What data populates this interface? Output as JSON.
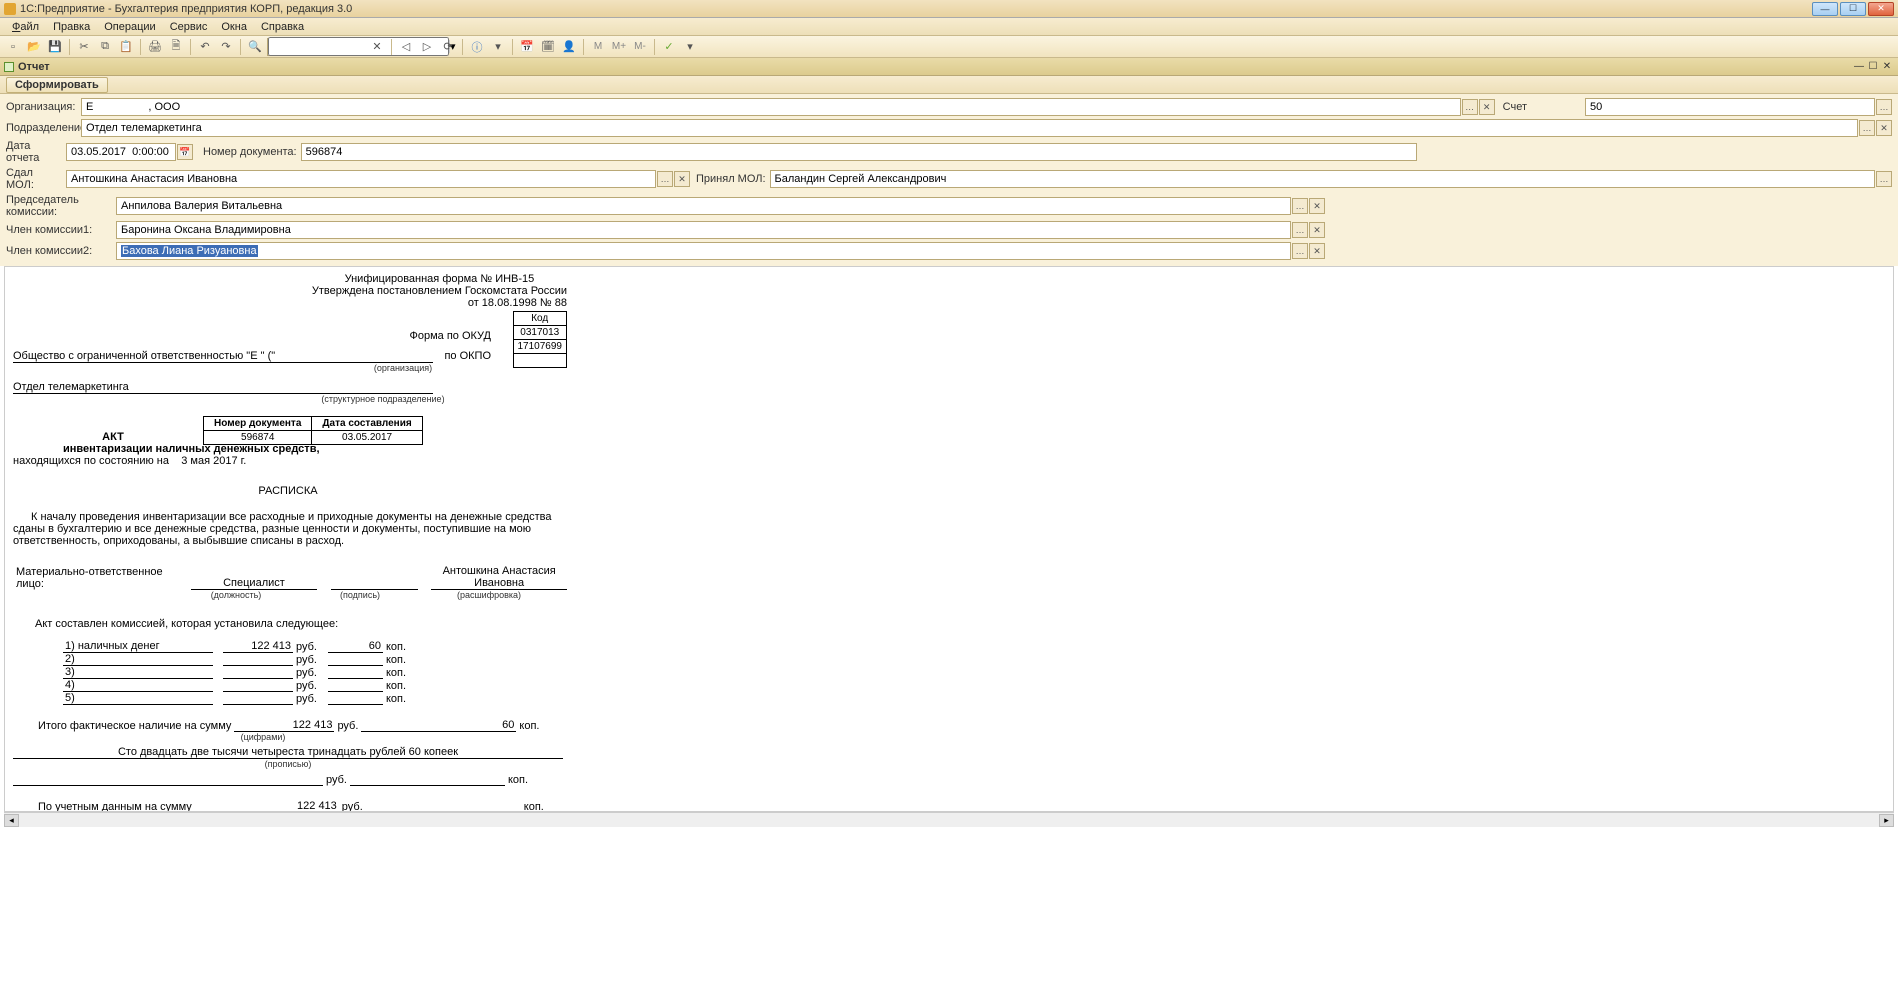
{
  "title": "1С:Предприятие - Бухгалтерия предприятия КОРП, редакция 3.0",
  "menu": {
    "file": "Файл",
    "edit": "Правка",
    "ops": "Операции",
    "service": "Сервис",
    "windows": "Окна",
    "help": "Справка"
  },
  "tab": "Отчет",
  "actionbtn": "Сформировать",
  "labels": {
    "org": "Организация:",
    "account": "Счет",
    "dept": "Подразделение:",
    "date": "Дата отчета",
    "docnum": "Номер документа:",
    "gave": "Сдал МОЛ:",
    "took": "Принял МОЛ:",
    "chair": "Председатель комиссии:",
    "m1": "Член комиссии1:",
    "m2": "Член комиссии2:"
  },
  "fields": {
    "org": "Е                  , ООО",
    "account": "50",
    "dept": "Отдел телемаркетинга",
    "date": "03.05.2017  0:00:00",
    "docnum": "596874",
    "gave": "Антошкина Анастасия Ивановна",
    "took": "Баландин Сергей Александрович",
    "chair": "Анпилова Валерия Витальевна",
    "m1": "Баронина Оксана Владимировна",
    "m2": "Бахова Лиана Ризуановна"
  },
  "doc": {
    "formLine": "Унифицированная форма № ИНВ-15",
    "approvedLine": "Утверждена постановлением Госкомстата России",
    "fromLine": "от 18.08.1998 № 88",
    "codeHdr": "Код",
    "okudLbl": "Форма по ОКУД",
    "okud": "0317013",
    "okpoLbl": "по ОКПО",
    "okpo": "17107699",
    "orgLine": "Общество с ограниченной ответственностью \"Е                \"  (\"",
    "orgCap": "(организация)",
    "deptLine": "Отдел телемаркетинга",
    "deptCap": "(структурное подразделение)",
    "docnumHdr": "Номер документа",
    "dateHdr": "Дата составления",
    "docnumVal": "596874",
    "dateVal": "03.05.2017",
    "actHdr": "АКТ",
    "actSub": "инвентаризации наличных денежных средств,",
    "asOf": "находящихся по состоянию на",
    "asOfDate": "3 мая 2017 г.",
    "receipt": "РАСПИСКА",
    "para": "К началу проведения инвентаризации все расходные и приходные документы на денежные средства сданы в бухгалтерию и все денежные средства, разные ценности и документы, поступившие на мою ответственность, оприходованы, а выбывшие списаны в расход.",
    "molLbl": "Материально-ответственное лицо:",
    "pos": "Специалист",
    "posCap": "(должность)",
    "sigCap": "(подпись)",
    "molName": "Антошкина Анастасия Ивановна",
    "nameCap": "(расшифровка)",
    "actLine": "Акт составлен комиссией, которая установила следующее:",
    "cash": "1) наличных денег",
    "rub": "руб.",
    "kop": "коп.",
    "amtRub": "122 413",
    "amtKop": "60",
    "totalFact": "Итого фактическое наличие на сумму",
    "digitsCap": "(цифрами)",
    "words": "Сто двадцать две тысячи четыреста тринадцать рублей 60 копеек",
    "wordsCap": "(прописью)",
    "byBooks": "По учетным данным на сумму"
  }
}
